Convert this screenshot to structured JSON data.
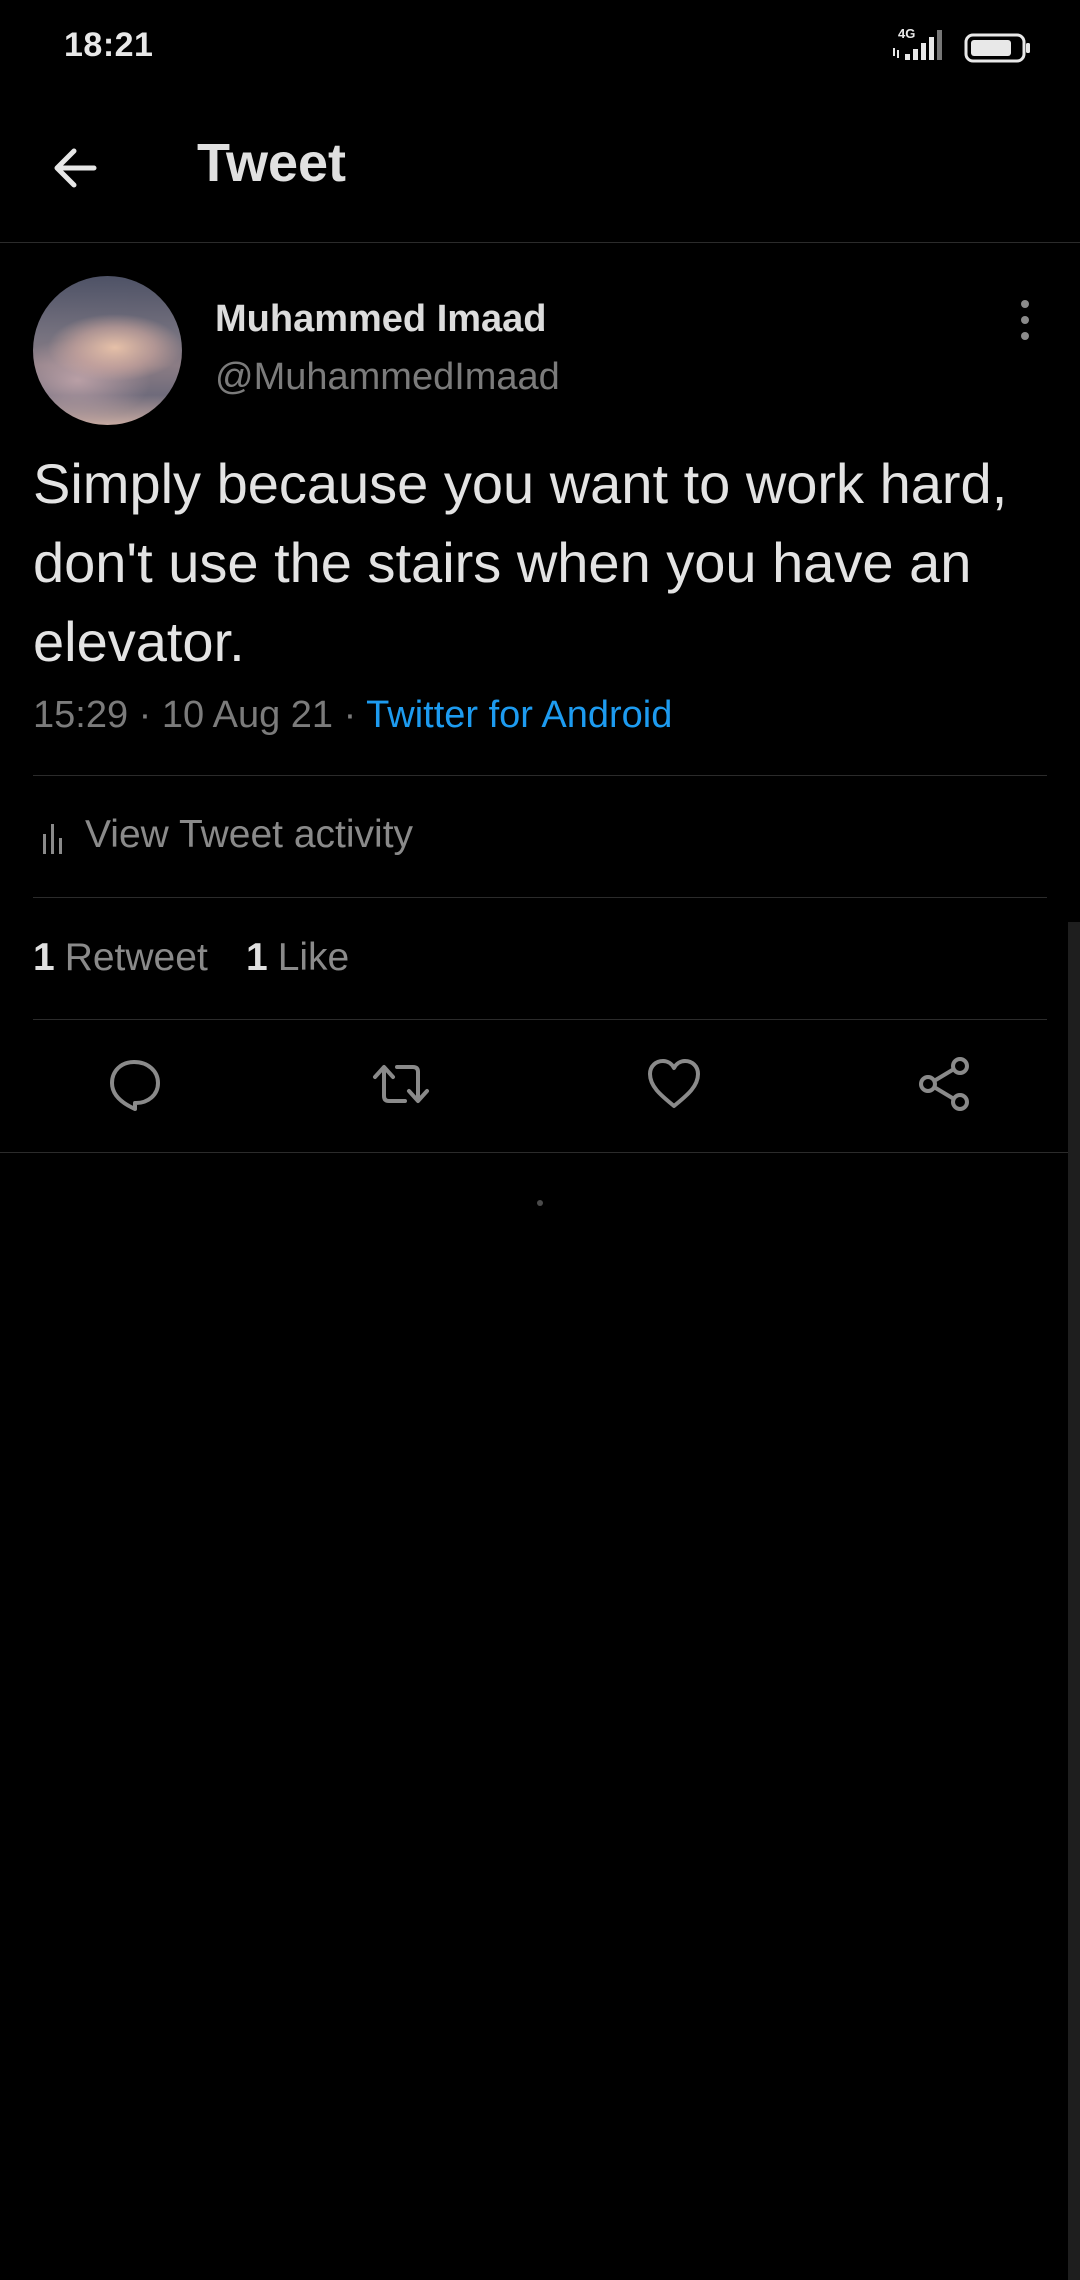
{
  "status_bar": {
    "time": "18:21",
    "network_label": "4G"
  },
  "header": {
    "title": "Tweet"
  },
  "tweet": {
    "author_name": "Muhammed Imaad",
    "author_handle": "@MuhammedImaad",
    "text": "Simply because you want to work hard, don't use the stairs when you have an elevator.",
    "time": "15:29",
    "date": "10 Aug 21",
    "separator": "·",
    "source": "Twitter for Android",
    "activity_label": "View Tweet activity",
    "retweet_count": "1",
    "retweet_label": "Retweet",
    "like_count": "1",
    "like_label": "Like"
  },
  "colors": {
    "background": "#000000",
    "link": "#1d9bf0",
    "secondary_text": "#7b7b7b"
  },
  "icons": {
    "back": "arrow-left-icon",
    "more": "more-vertical-icon",
    "activity": "bar-chart-icon",
    "reply": "reply-icon",
    "retweet": "retweet-icon",
    "like": "heart-icon",
    "share": "share-icon"
  }
}
